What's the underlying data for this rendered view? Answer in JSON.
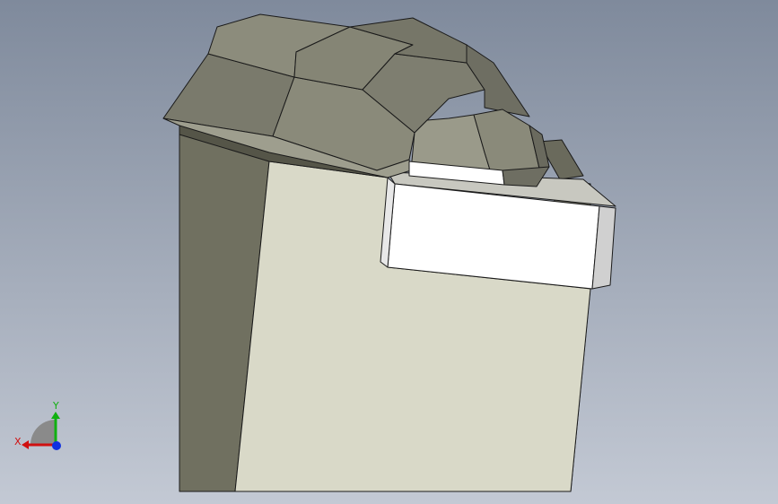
{
  "viewport": {
    "background_top": "#7f8a9c",
    "background_bottom": "#c3c9d4"
  },
  "model": {
    "colors": {
      "face_light": "#d9d9c8",
      "face_dark": "#707060",
      "face_mid": "#8c8c7c",
      "bracket_face": "#ffffff",
      "bracket_side": "#d8d8d8",
      "edge": "#1a1a1a"
    }
  },
  "triad": {
    "x_label": "X",
    "y_label": "Y",
    "x_color": "#d01010",
    "y_color": "#10b010",
    "z_color": "#1030e0",
    "sector_color": "#8a8a8a"
  }
}
